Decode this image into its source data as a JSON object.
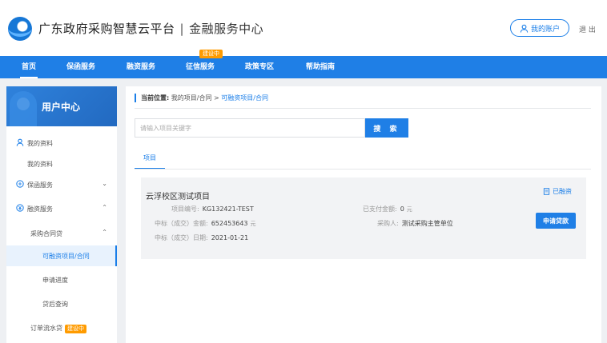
{
  "header": {
    "title": "广东政府采购智慧云平台",
    "separator": "|",
    "subtitle": "金融服务中心",
    "account_label": "我的账户",
    "logout_label": "退 出"
  },
  "nav": {
    "items": [
      {
        "label": "首页"
      },
      {
        "label": "保函服务"
      },
      {
        "label": "融资服务"
      },
      {
        "label": "征信服务"
      },
      {
        "label": "政策专区"
      },
      {
        "label": "帮助指南"
      }
    ],
    "badge": "建设中"
  },
  "sidebar": {
    "title": "用户中心",
    "items": [
      {
        "label": "我的资料"
      },
      {
        "label": "我的资料"
      },
      {
        "label": "保函服务"
      },
      {
        "label": "融资服务"
      },
      {
        "label": "采购合同贷"
      },
      {
        "label": "可融资项目/合同"
      },
      {
        "label": "申请进度"
      },
      {
        "label": "贷后查询"
      },
      {
        "label": "订单流水贷"
      }
    ],
    "badge": "建设中"
  },
  "breadcrumb": {
    "label": "当前位置:",
    "path": "我的项目/合同 >",
    "current": "可融资项目/合同"
  },
  "search": {
    "placeholder": "请输入项目关键字",
    "value": "",
    "button": "搜 索"
  },
  "tab": {
    "label": "项目"
  },
  "project": {
    "title": "云浮校区测试项目",
    "code_label": "项目编号:",
    "code": "KG132421-TEST",
    "amount_label": "中标（成交）金额:",
    "amount": "652453643",
    "amount_unit": "元",
    "date_label": "中标（成交）日期:",
    "date": "2021-01-21",
    "paid_label": "已支付金额:",
    "paid": "0",
    "paid_unit": "元",
    "buyer_label": "采购人:",
    "buyer": "测试采购主管单位",
    "status": "已融资",
    "apply_button": "申请贷款"
  },
  "colors": {
    "primary": "#1f7fe6",
    "badge": "#ff9b00"
  }
}
